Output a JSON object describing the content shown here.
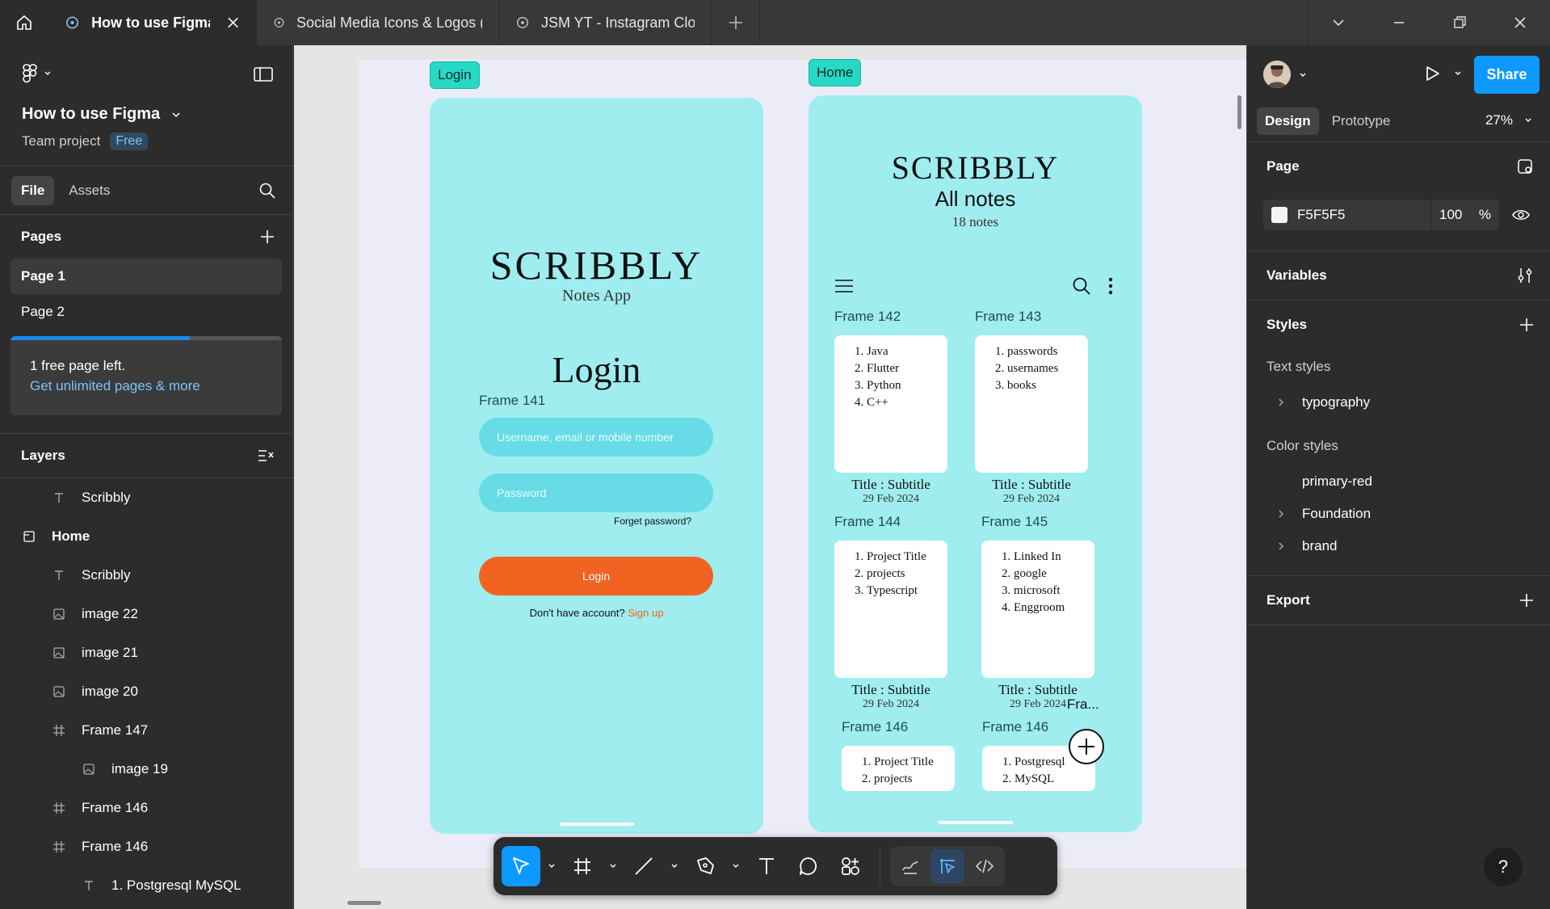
{
  "titlebar": {
    "tabs": [
      {
        "label": "How to use Figma",
        "active": true
      },
      {
        "label": "Social Media Icons & Logos (Commun",
        "active": false
      },
      {
        "label": "JSM YT - Instagram Clone",
        "active": false
      }
    ]
  },
  "file": {
    "name": "How to use Figma",
    "team": "Team project",
    "plan": "Free"
  },
  "left_tabs": {
    "file": "File",
    "assets": "Assets"
  },
  "pages": {
    "title": "Pages",
    "items": [
      "Page 1",
      "Page 2"
    ],
    "promo_line1": "1 free page left.",
    "promo_line2": "Get unlimited pages & more",
    "promo_progress": 0.66
  },
  "layers": {
    "title": "Layers",
    "items": [
      {
        "label": "Scribbly",
        "icon": "text-icon",
        "indent": 1
      },
      {
        "label": "Home",
        "icon": "frame-root-icon",
        "indent": 0
      },
      {
        "label": "Scribbly",
        "icon": "text-icon",
        "indent": 1
      },
      {
        "label": "image 22",
        "icon": "image-icon",
        "indent": 1
      },
      {
        "label": "image 21",
        "icon": "image-icon",
        "indent": 1
      },
      {
        "label": "image 20",
        "icon": "image-icon",
        "indent": 1
      },
      {
        "label": "Frame 147",
        "icon": "frame-icon",
        "indent": 1
      },
      {
        "label": "image 19",
        "icon": "image-icon",
        "indent": 2
      },
      {
        "label": "Frame 146",
        "icon": "frame-icon",
        "indent": 1
      },
      {
        "label": "Frame 146",
        "icon": "frame-icon",
        "indent": 1
      },
      {
        "label": "1. Postgresql MySQL",
        "icon": "text-icon",
        "indent": 2
      }
    ]
  },
  "canvas": {
    "login_tag": "Login",
    "home_tag": "Home",
    "login_screen": {
      "brand": "SCRIBBLY",
      "tagline": "Notes App",
      "heading": "Login",
      "frame_label": "Frame 141",
      "username_placeholder": "Username, email or mobile number",
      "password_placeholder": "Password",
      "forget": "Forget password?",
      "button": "Login",
      "no_account": "Don't have account?",
      "signup": "Sign up"
    },
    "home_screen": {
      "brand": "SCRIBBLY",
      "title": "All notes",
      "count": "18 notes",
      "cards": [
        {
          "frame": "Frame 142",
          "items": [
            "Java",
            "Flutter",
            "Python",
            "C++"
          ],
          "title": "Title : Subtitle",
          "date": "29 Feb 2024"
        },
        {
          "frame": "Frame 143",
          "items": [
            "passwords",
            "usernames",
            "books"
          ],
          "title": "Title : Subtitle",
          "date": "29 Feb 2024"
        },
        {
          "frame": "Frame 144",
          "items": [
            "Project Title",
            "projects",
            "Typescript"
          ],
          "title": "Title : Subtitle",
          "date": "29 Feb 2024"
        },
        {
          "frame": "Frame 145",
          "items": [
            "Linked In",
            "google",
            "microsoft",
            "Enggroom"
          ],
          "title": "Title : Subtitle",
          "date": "29 Feb 2024"
        },
        {
          "frame": "Frame 146",
          "items": [
            "Project Title",
            "projects"
          ]
        },
        {
          "frame": "Frame 146",
          "items": [
            "Postgresql",
            "MySQL"
          ]
        }
      ],
      "truncated_frame": "Fra..."
    }
  },
  "right": {
    "share": "Share",
    "tabs": {
      "design": "Design",
      "prototype": "Prototype"
    },
    "zoom": "27%",
    "page": {
      "title": "Page",
      "color": "F5F5F5",
      "opacity": "100",
      "percent": "%"
    },
    "variables": "Variables",
    "styles": {
      "title": "Styles",
      "text_styles": "Text styles",
      "text_items": [
        "typography"
      ],
      "color_styles": "Color styles",
      "color_items": [
        {
          "label": "primary-red",
          "expandable": false
        },
        {
          "label": "Foundation",
          "expandable": true
        },
        {
          "label": "brand",
          "expandable": true
        }
      ]
    },
    "export": "Export",
    "help": "?"
  },
  "colors": {
    "accent": "#0d99ff",
    "phone_bg": "#9fedef",
    "login_button": "#f26322",
    "frame_tag": "#27d9c5"
  }
}
